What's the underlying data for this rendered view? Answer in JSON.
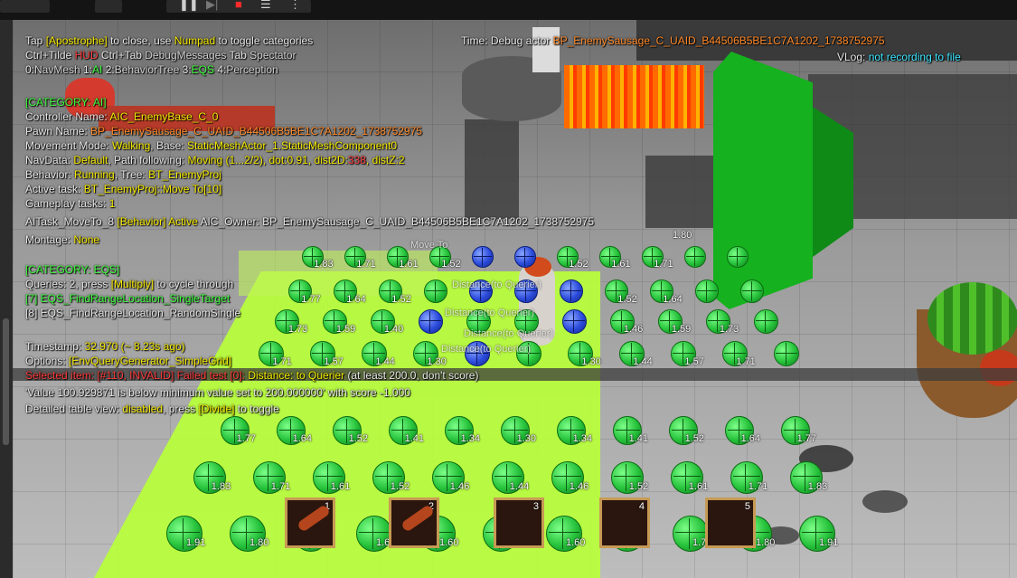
{
  "toolbar": {
    "icons": [
      "pause-icon",
      "step-icon",
      "stop-icon",
      "menu-icon",
      "more-icon"
    ]
  },
  "hud": {
    "line1": {
      "a": "Tap ",
      "key1": "[Apostrophe]",
      "b": " to close, use ",
      "key2": "Numpad",
      "c": " to toggle categories"
    },
    "line2": {
      "a": "Ctrl+Tilde ",
      "b": "HUD",
      "c": "  Ctrl+Tab ",
      "d": "DebugMessages",
      "e": "  Tab ",
      "f": "Spectator"
    },
    "line3": {
      "a": "0:",
      "b": "NavMesh",
      "c": " 1:",
      "d": "AI",
      "e": "  2:",
      "f": "BehaviorTree",
      "g": "  3:",
      "h": "EQS",
      "i": "  4:",
      "j": "Perception"
    },
    "time": {
      "label": "Time: ",
      "value": "Debug actor ",
      "actor": "BP_EnemySausage_C_UAID_B44506B5BE1C7A1202_1738752975"
    },
    "vlog": {
      "label": "VLog: ",
      "value": "not recording to file"
    },
    "ai": {
      "category": "[CATEGORY: AI]",
      "controller": {
        "label": "Controller Name: ",
        "value": "AIC_EnemyBase_C_0"
      },
      "pawn": {
        "label": "Pawn Name: ",
        "value": "BP_EnemySausage_C_UAID_B44506B5BE1C7A1202_1738752975"
      },
      "movement": {
        "label": "Movement Mode: ",
        "value": "Walking",
        "label2": ", Base: ",
        "value2": "StaticMeshActor_1.StaticMeshComponent0"
      },
      "navdata": {
        "label": "NavData: ",
        "value": "Default",
        "label2": ", Path following: ",
        "value2": "Moving (1...2/2), dot:0.91, dist2D:",
        "value3": "338",
        "value4": ", distZ:2"
      },
      "behavior": {
        "label": "Behavior: ",
        "value": "Running",
        "label2": ", Tree: ",
        "value2": "BT_EnemyProj"
      },
      "active_task": {
        "label": "Active task: ",
        "value": "BT_EnemyProj::Move To[10]"
      },
      "gameplay_tasks": {
        "label": "Gameplay tasks: ",
        "value": "1"
      },
      "aitask": {
        "a": "  AITask_MoveTo_8 ",
        "b": "[Behavior]",
        "c": " Active ",
        "d": "AIC_Owner: BP_EnemySausage_C_UAID_B44506B5BE1C7A1202_1738752975"
      },
      "montage": {
        "label": "Montage: ",
        "value": "None"
      }
    },
    "eqs": {
      "category": "[CATEGORY: EQS]",
      "queries": {
        "a": "Queries: 2, press ",
        "b": "[Multiply]",
        "c": " to cycle through"
      },
      "q7": "[7] EQS_FindRangeLocation_SingleTarget",
      "q8": "[8] EQS_FindRangeLocation_RandomSingle",
      "timestamp": {
        "label": "Timestamp: ",
        "value": "32.970 (~ 8.23s ago)"
      },
      "options": {
        "label": "Options: ",
        "value": "[EnvQueryGenerator_SimpleGrid]"
      },
      "selected": {
        "a": "Selected item: ",
        "b": "[#110, INVALID] Failed test [0]:",
        "c": "  Distance: to Querier",
        "d": " (at least 200.0, don't score)"
      },
      "value_line": "  'Value 100.929871 is below minimum value set to 200.000000' with score -1.000",
      "detailed": {
        "a": "Detailed table view: ",
        "b": "disabled",
        "c": ", press ",
        "d": "[Divide]",
        "e": " to toggle"
      }
    }
  },
  "scene_labels": {
    "distance": "Distance(to Querier)",
    "move_to": "Move To",
    "score_80": "1.80"
  },
  "eqs_rows": [
    {
      "scores": [
        "1.83",
        "1.71",
        "1.61",
        "1.52",
        "",
        "",
        "1.52",
        "1.61",
        "1.71",
        "",
        ""
      ]
    },
    {
      "scores": [
        "1.77",
        "1.64",
        "1.52",
        "",
        "",
        "",
        "",
        "1.52",
        "1.64",
        "",
        ""
      ]
    },
    {
      "scores": [
        "1.73",
        "1.59",
        "1.40",
        "",
        "",
        "",
        "",
        "1.46",
        "1.59",
        "1.73",
        ""
      ]
    },
    {
      "scores": [
        "1.71",
        "1.57",
        "1.44",
        "1.30",
        "",
        "",
        "1.30",
        "1.44",
        "1.57",
        "1.71",
        ""
      ]
    },
    {
      "scores": [
        "1.77",
        "1.64",
        "1.52",
        "1.41",
        "1.34",
        "1.30",
        "1.34",
        "1.41",
        "1.52",
        "1.64",
        "1.77"
      ]
    },
    {
      "scores": [
        "1.83",
        "1.71",
        "1.61",
        "1.52",
        "1.46",
        "1.44",
        "1.46",
        "1.52",
        "1.61",
        "1.71",
        "1.83"
      ]
    },
    {
      "scores": [
        "1.91",
        "1.80",
        "1.71",
        "1.64",
        "1.60",
        "1.57",
        "1.60",
        "1.64",
        "1.71",
        "1.80",
        "1.91"
      ]
    }
  ],
  "hotbar": {
    "slots": [
      {
        "num": "1",
        "item": "sausage"
      },
      {
        "num": "2",
        "item": "sausage"
      },
      {
        "num": "3",
        "item": ""
      },
      {
        "num": "4",
        "item": ""
      },
      {
        "num": "5",
        "item": ""
      }
    ]
  },
  "colors": {
    "highlight_yellow": "#f5e900",
    "highlight_orange": "#ff8a2a",
    "cyan": "#3ee7ff",
    "eqs_green": "#3fff3f",
    "error_red": "#ff3b3b",
    "eqs_floor": "#b8ff3a"
  }
}
